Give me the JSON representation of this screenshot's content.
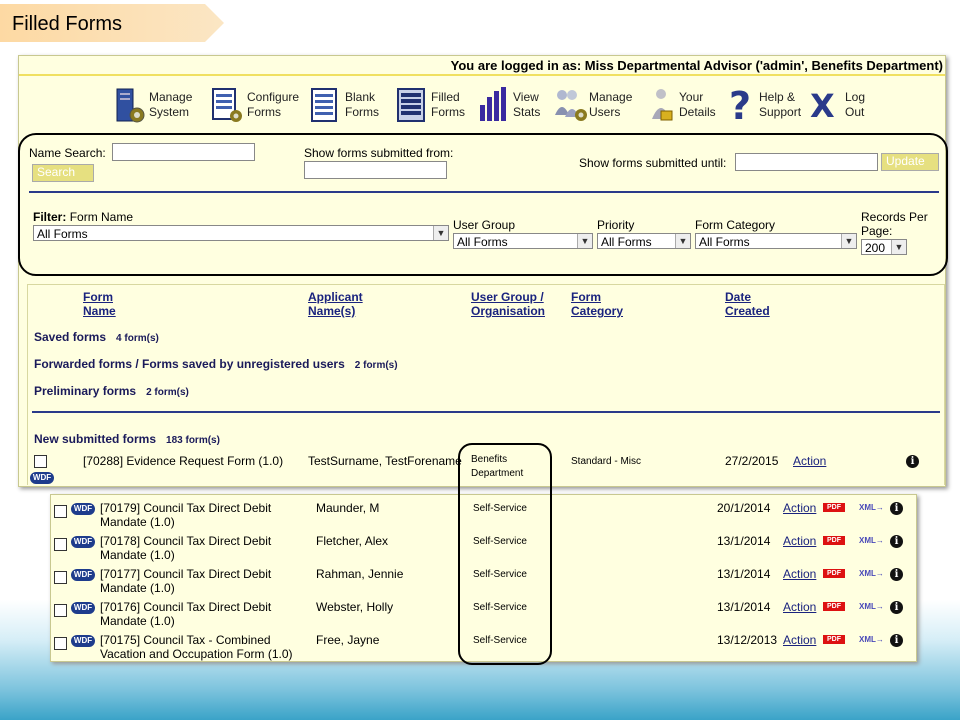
{
  "slide_title": "Filled Forms",
  "login_text": "You are logged in as: Miss Departmental Advisor ('admin', Benefits Department)",
  "nav": [
    {
      "label": "Manage\nSystem",
      "icon": "server-gear-icon"
    },
    {
      "label": "Configure\nForms",
      "icon": "configure-forms-icon"
    },
    {
      "label": "Blank\nForms",
      "icon": "blank-forms-icon"
    },
    {
      "label": "Filled\nForms",
      "icon": "filled-forms-icon"
    },
    {
      "label": "View\nStats",
      "icon": "bar-chart-icon"
    },
    {
      "label": "Manage\nUsers",
      "icon": "users-icon"
    },
    {
      "label": "Your\nDetails",
      "icon": "user-lock-icon"
    },
    {
      "label": "Help &\nSupport",
      "icon": "question-mark-icon"
    },
    {
      "label": "Log\nOut",
      "icon": "x-logout-icon"
    }
  ],
  "filters": {
    "name_search_label": "Name Search:",
    "name_search_value": "",
    "search_button": "Search",
    "submitted_from_label": "Show forms submitted from:",
    "submitted_from_value": "",
    "submitted_until_label": "Show forms submitted until:",
    "submitted_until_value": "",
    "update_button": "Update",
    "filter_label": "Filter:",
    "form_name_label": "Form Name",
    "form_name_value": "All Forms",
    "user_group_label": "User Group",
    "user_group_value": "All Forms",
    "priority_label": "Priority",
    "priority_value": "All Forms",
    "form_category_label": "Form Category",
    "form_category_value": "All Forms",
    "records_per_page_label_1": "Records Per",
    "records_per_page_label_2": "Page:",
    "records_per_page_value": "200"
  },
  "columns": {
    "form_name_1": "Form",
    "form_name_2": "Name",
    "applicant_1": "Applicant",
    "applicant_2": "Name(s)",
    "user_group_1": "User Group /",
    "user_group_2": "Organisation",
    "form_category_1": "Form",
    "form_category_2": "Category",
    "date_created_1": "Date",
    "date_created_2": "Created"
  },
  "sections": {
    "saved_label": "Saved forms",
    "saved_count": "4 form(s)",
    "forwarded_label": "Forwarded forms / Forms saved by unregistered users",
    "forwarded_count": "2 form(s)",
    "preliminary_label": "Preliminary forms",
    "preliminary_count": "2 form(s)",
    "new_label": "New submitted forms",
    "new_count": "183 form(s)"
  },
  "first_row": {
    "form": "[70288]  Evidence Request Form (1.0)",
    "applicant": "TestSurname, TestForename",
    "group_1": "Benefits",
    "group_2": "Department",
    "category": "Standard - Misc",
    "date": "27/2/2015",
    "action": "Action"
  },
  "rows": [
    {
      "form_1": "[70179]  Council Tax Direct Debit",
      "form_2": "Mandate (1.0)",
      "applicant": "Maunder, M",
      "group": "Self-Service",
      "date": "20/1/2014",
      "action": "Action"
    },
    {
      "form_1": "[70178]  Council Tax Direct Debit",
      "form_2": "Mandate (1.0)",
      "applicant": "Fletcher, Alex",
      "group": "Self-Service",
      "date": "13/1/2014",
      "action": "Action"
    },
    {
      "form_1": "[70177]  Council Tax Direct Debit",
      "form_2": "Mandate (1.0)",
      "applicant": "Rahman, Jennie",
      "group": "Self-Service",
      "date": "13/1/2014",
      "action": "Action"
    },
    {
      "form_1": "[70176]  Council Tax Direct Debit",
      "form_2": "Mandate (1.0)",
      "applicant": "Webster, Holly",
      "group": "Self-Service",
      "date": "13/1/2014",
      "action": "Action"
    },
    {
      "form_1": "[70175]  Council Tax - Combined",
      "form_2": "Vacation and Occupation Form (1.0)",
      "applicant": "Free, Jayne",
      "group": "Self-Service",
      "date": "13/12/2013",
      "action": "Action"
    }
  ],
  "badges": {
    "wdf": "WDF",
    "pdf": "PDF",
    "xml": "XML",
    "info": "i"
  },
  "colors": {
    "header_bg": "#ffffe0",
    "link": "#1a237e",
    "title_tab": "#fdd9a3",
    "rule": "#2a3a8a"
  }
}
